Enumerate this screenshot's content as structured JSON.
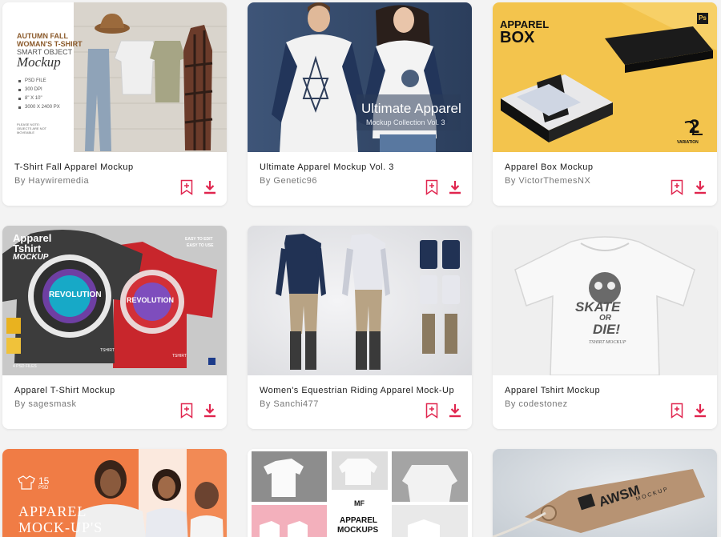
{
  "colors": {
    "accent": "#e0254e",
    "card_bg": "#ffffff",
    "page_bg": "#f3f3f3"
  },
  "cards": [
    {
      "title": "T-Shirt Fall Apparel Mockup",
      "author": "By Haywiremedia",
      "overlay": {
        "line1": "AUTUMN FALL",
        "line2": "WOMAN'S T-SHIRT",
        "line3": "SMART OBJECT",
        "line4": "Mockup",
        "specs": [
          "PSD FILE",
          "300 DPI",
          "8\" X 10\"",
          "3000 X 2400 PX"
        ],
        "note1": "PLEASE NOTE:",
        "note2": "OBJECTS ARE NOT",
        "note3": "MOVEABLE"
      }
    },
    {
      "title": "Ultimate Apparel Mockup Vol. 3",
      "author": "By Genetic96",
      "overlay": {
        "line1": "Ultimate Apparel",
        "line2": "Mockup Collection Vol. 3"
      }
    },
    {
      "title": "Apparel Box Mockup",
      "author": "By VictorThemesNX",
      "overlay": {
        "line1": "APPAREL",
        "line2": "BOX",
        "badge": "Ps",
        "number": "2",
        "variation": "VARIATION"
      }
    },
    {
      "title": "Apparel T-Shirt Mockup",
      "author": "By sagesmask",
      "overlay": {
        "line1": "Apparel",
        "line2": "Tshirt",
        "line3": "MOCKUP",
        "easy1": "EASY TO EDIT",
        "easy2": "EASY TO USE",
        "revolution": "REVOLUTION",
        "psd": "4 PSD FILES",
        "tshirt": "TSHIRT"
      }
    },
    {
      "title": "Women's Equestrian Riding Apparel Mock-Up",
      "author": "By Sanchi477",
      "overlay": {}
    },
    {
      "title": "Apparel Tshirt Mockup",
      "author": "By codestonez",
      "overlay": {
        "print1": "SKATE",
        "print2": "OR",
        "print3": "DIE!",
        "print4": "TSHIRT MOCKUP"
      }
    },
    {
      "overlay": {
        "count": "15",
        "psd": "PSD",
        "line1": "APPAREL",
        "line2": "MOCK-UP'S"
      }
    },
    {
      "overlay": {
        "logo": "MF",
        "line1": "APPAREL",
        "line2": "MOCKUPS"
      }
    },
    {
      "overlay": {
        "logo": "AWSM",
        "sub": "MOCKUP"
      }
    }
  ]
}
